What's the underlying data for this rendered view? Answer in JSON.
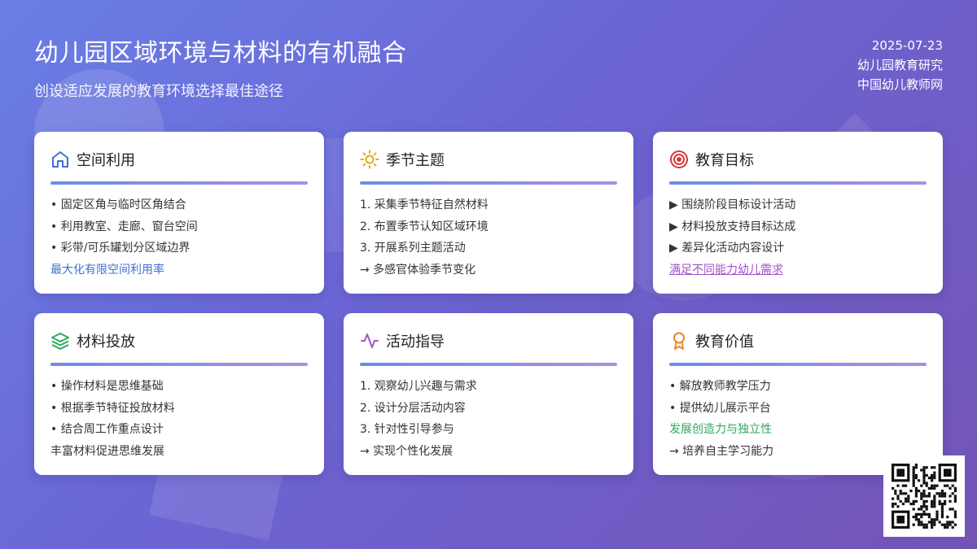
{
  "header": {
    "title": "幼儿园区域环境与材料的有机融合",
    "subtitle": "创设适应发展的教育环境选择最佳途径"
  },
  "meta": {
    "date": "2025-07-23",
    "line1": "幼儿园教育研究",
    "line2": "中国幼儿教师网"
  },
  "cards": [
    {
      "title": "空间利用",
      "icon": "house-icon",
      "lines": [
        "• 固定区角与临时区角结合",
        "• 利用教室、走廊、窗台空间",
        "• 彩带/可乐罐划分区域边界",
        "最大化有限空间利用率"
      ]
    },
    {
      "title": "季节主题",
      "icon": "sun-icon",
      "lines": [
        "1. 采集季节特征自然材料",
        "2. 布置季节认知区域环境",
        "3. 开展系列主题活动",
        "→ 多感官体验季节变化"
      ]
    },
    {
      "title": "教育目标",
      "icon": "target-icon",
      "lines": [
        "▶ 围绕阶段目标设计活动",
        "▶ 材料投放支持目标达成",
        "▶ 差异化活动内容设计",
        "满足不同能力幼儿需求"
      ]
    },
    {
      "title": "材料投放",
      "icon": "layers-icon",
      "lines": [
        "• 操作材料是思维基础",
        "• 根据季节特征投放材料",
        "• 结合周工作重点设计",
        "丰富材料促进思维发展"
      ]
    },
    {
      "title": "活动指导",
      "icon": "activity-icon",
      "lines": [
        "1. 观察幼儿兴趣与需求",
        "2. 设计分层活动内容",
        "3. 针对性引导参与",
        "→ 实现个性化发展"
      ]
    },
    {
      "title": "教育价值",
      "icon": "award-icon",
      "lines": [
        "• 解放教师教学压力",
        "• 提供幼儿展示平台",
        "发展创造力与独立性",
        "→ 培养自主学习能力"
      ]
    }
  ],
  "colors": {
    "accent_blue": "#3f6fd6",
    "accent_purple": "#a052c8",
    "accent_green": "#2ea85a"
  }
}
